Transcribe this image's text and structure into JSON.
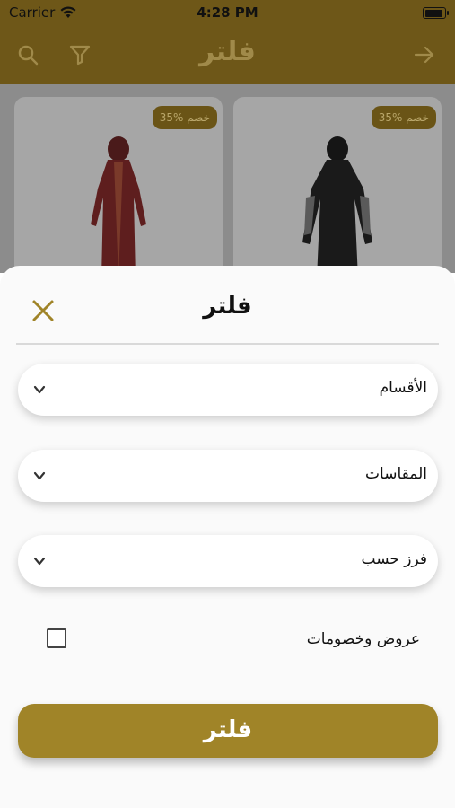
{
  "status_bar": {
    "carrier": "Carrier",
    "time": "4:28 PM"
  },
  "nav": {
    "title": "فلتر"
  },
  "products": [
    {
      "discount": "35% خصم"
    },
    {
      "discount": "35% خصم"
    }
  ],
  "filter_sheet": {
    "title": "فلتر",
    "dropdowns": [
      {
        "label": "الأقسام"
      },
      {
        "label": "المقاسات"
      },
      {
        "label": "فرز حسب"
      }
    ],
    "offers_label": "عروض وخصومات",
    "offers_checked": false,
    "apply_label": "فلتر"
  },
  "colors": {
    "brand": "#6e5718",
    "accent": "#a08428"
  }
}
